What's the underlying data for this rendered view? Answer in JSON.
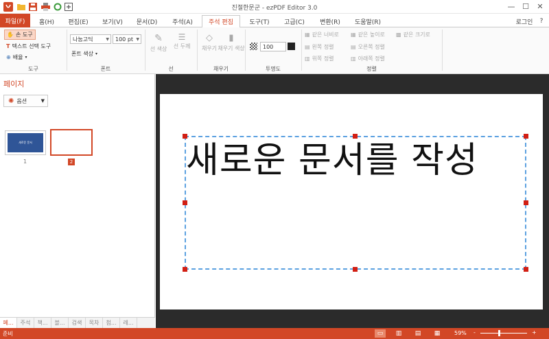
{
  "window": {
    "title": "진절한문군 - ezPDF Editor 3.0",
    "minimize": "—",
    "maximize": "☐",
    "close": "✕"
  },
  "tabs": {
    "file": "파일(F)",
    "items": [
      "홈(H)",
      "편집(E)",
      "보기(V)",
      "문서(D)",
      "주석(A)",
      "주석 편집",
      "도구(T)",
      "고급(C)",
      "변환(R)",
      "도움말(R)"
    ],
    "login": "로그인",
    "help": "?"
  },
  "ribbon": {
    "tools": {
      "hand": "손 도구",
      "text_select": "텍스트 선택 도구",
      "arrange": "배율",
      "group": "도구"
    },
    "font": {
      "family": "나눔고딕",
      "size": "100 pt",
      "color": "폰트 색상",
      "group": "폰트"
    },
    "line": {
      "color": "선 색상",
      "width": "선 두께",
      "group": "선"
    },
    "fill": {
      "fill": "채우기",
      "fill_color": "채우기 색상",
      "group": "채우기"
    },
    "opacity": {
      "value": "100",
      "group": "투명도"
    },
    "align": {
      "same_width": "같은 너비로",
      "same_height": "같은 높이로",
      "same_size": "같은 크기로",
      "left": "왼쪽 정렬",
      "right": "오른쪽 정렬",
      "top": "위쪽 정렬",
      "bottom": "아래쪽 정렬",
      "group": "정렬"
    }
  },
  "left_panel": {
    "header": "페이지",
    "options": "옵션",
    "thumb1_text": "새로운 문서",
    "page1": "1",
    "page2": "2",
    "bottom_tabs": [
      "페...",
      "주석",
      "책...",
      "블...",
      "검색",
      "목차",
      "첨...",
      "레..."
    ]
  },
  "document": {
    "text": "새로운 문서를 작성"
  },
  "status": {
    "ready": "준비",
    "zoom": "59%",
    "minus": "-",
    "plus": "+",
    "zoom_level": 0.59
  },
  "colors": {
    "accent": "#d24726",
    "selection": "#5aa0e0",
    "handle": "#d21f14",
    "workspace": "#2b2b2b"
  }
}
